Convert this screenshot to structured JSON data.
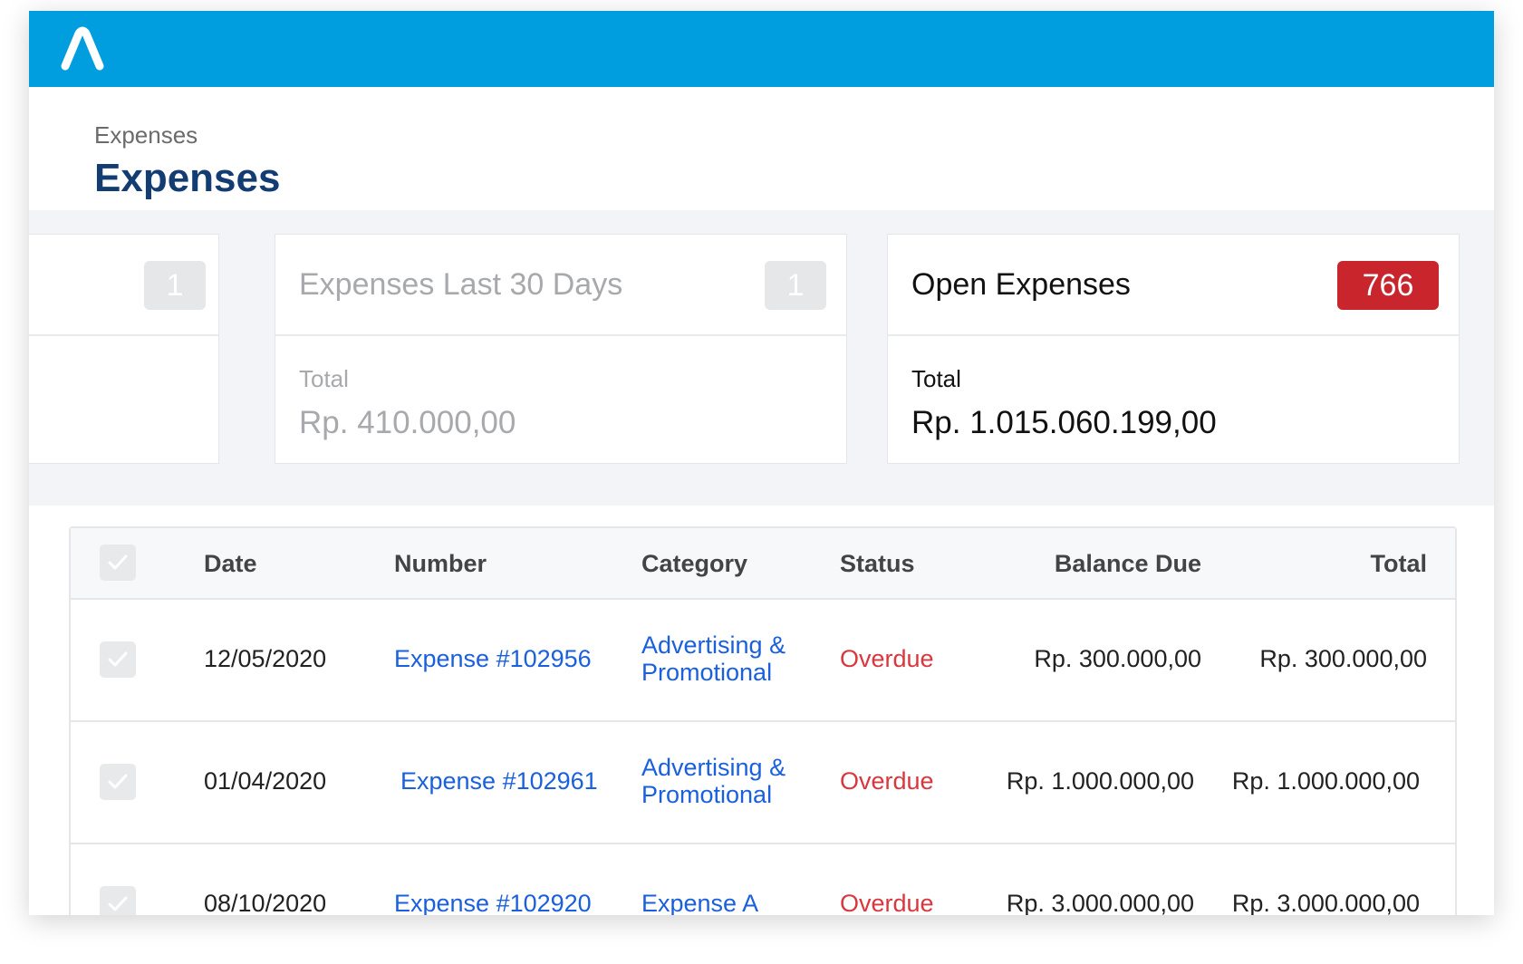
{
  "app": {
    "logo_icon": "brand-a-logo-icon",
    "brand_color": "#009ddf"
  },
  "header": {
    "breadcrumb": "Expenses",
    "title": "Expenses"
  },
  "cards": [
    {
      "title": "",
      "badge": "1",
      "label": "",
      "amount": ""
    },
    {
      "title": "Expenses Last 30 Days",
      "badge": "1",
      "label": "Total",
      "amount": "Rp. 410.000,00"
    },
    {
      "title": "Open Expenses",
      "badge": "766",
      "label": "Total",
      "amount": "Rp. 1.015.060.199,00"
    }
  ],
  "colors": {
    "title": "#133c73",
    "link": "#1a5fdc",
    "overdue": "#d9363e",
    "badge_alert": "#c9252c"
  },
  "table": {
    "columns": [
      "Date",
      "Number",
      "Category",
      "Status",
      "Balance Due",
      "Total"
    ],
    "rows": [
      {
        "date": "12/05/2020",
        "number": "Expense #102956",
        "category": "Advertising & Promotional",
        "status": "Overdue",
        "balance_due": "Rp. 300.000,00",
        "total": "Rp. 300.000,00"
      },
      {
        "date": "01/04/2020",
        "number": "Expense #102961",
        "category": "Advertising & Promotional",
        "status": "Overdue",
        "balance_due": "Rp. 1.000.000,00",
        "total": "Rp. 1.000.000,00"
      },
      {
        "date": "08/10/2020",
        "number": "Expense #102920",
        "category": "Expense A",
        "status": "Overdue",
        "balance_due": "Rp. 3.000.000,00",
        "total": "Rp. 3.000.000,00"
      }
    ]
  }
}
